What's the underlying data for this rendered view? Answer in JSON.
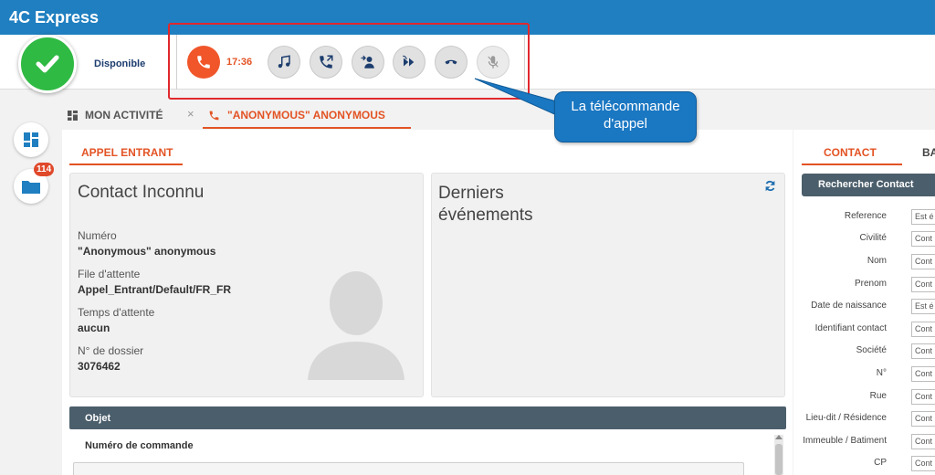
{
  "app": {
    "title": "4C Express"
  },
  "status": {
    "label": "Disponible"
  },
  "remote": {
    "timer": "17:36",
    "buttons": [
      {
        "name": "active-call-button",
        "icon": "phone-icon"
      },
      {
        "name": "music-hold-button",
        "icon": "music-note-icon"
      },
      {
        "name": "transfer-call-button",
        "icon": "phone-transfer-icon"
      },
      {
        "name": "consult-agent-button",
        "icon": "person-transfer-icon"
      },
      {
        "name": "forward-button",
        "icon": "fast-forward-icon"
      },
      {
        "name": "hang-up-button",
        "icon": "hang-up-icon"
      },
      {
        "name": "mute-button",
        "icon": "microphone-icon"
      }
    ]
  },
  "callout": {
    "text": "La télécommande d'appel"
  },
  "rail": {
    "badge": "114"
  },
  "tabs": {
    "activity": "MON ACTIVITÉ",
    "call": "\"ANONYMOUS\" ANONYMOUS",
    "close": "×"
  },
  "sub_tab": "APPEL ENTRANT",
  "contact_card": {
    "title": "Contact Inconnu",
    "fields": [
      {
        "label": "Numéro",
        "value": "\"Anonymous\" anonymous"
      },
      {
        "label": "File d'attente",
        "value": "Appel_Entrant/Default/FR_FR"
      },
      {
        "label": "Temps d'attente",
        "value": "aucun"
      },
      {
        "label": "N° de dossier",
        "value": "3076462"
      }
    ]
  },
  "events_card": {
    "title_line1": "Derniers",
    "title_line2": "événements"
  },
  "objet": {
    "header": "Objet",
    "field_label": "Numéro de commande"
  },
  "right_panel": {
    "tab_contact": "CONTACT",
    "tab_other": "BA",
    "search_header": "Rechercher Contact",
    "fields": [
      {
        "label": "Reference",
        "value": "Est é"
      },
      {
        "label": "Civilité",
        "value": "Cont"
      },
      {
        "label": "Nom",
        "value": "Cont"
      },
      {
        "label": "Prenom",
        "value": "Cont"
      },
      {
        "label": "Date de naissance",
        "value": "Est é"
      },
      {
        "label": "Identifiant contact",
        "value": "Cont"
      },
      {
        "label": "Société",
        "value": "Cont"
      },
      {
        "label": "N°",
        "value": "Cont"
      },
      {
        "label": "Rue",
        "value": "Cont"
      },
      {
        "label": "Lieu-dit / Résidence",
        "value": "Cont"
      },
      {
        "label": "Immeuble / Batiment",
        "value": "Cont"
      },
      {
        "label": "CP",
        "value": "Cont"
      }
    ]
  },
  "colors": {
    "brand": "#1f7fc0",
    "accent": "#e35324",
    "status": "#2fba43",
    "highlight": "#e0282d"
  }
}
